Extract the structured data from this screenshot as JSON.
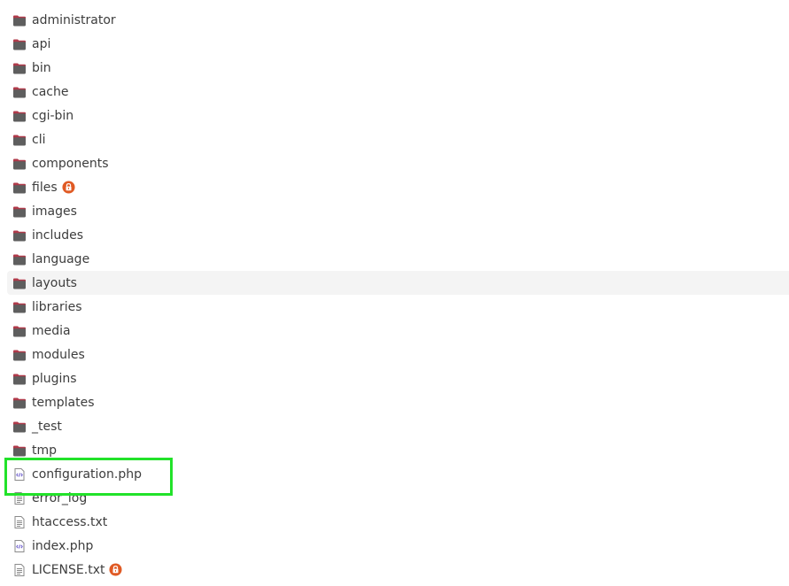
{
  "colors": {
    "folder_body": "#5e5e5e",
    "folder_tab": "#b03a4a",
    "lock_badge": "#e05a24",
    "highlight_border": "#22e22a",
    "hover_row": "#f4f4f4",
    "text": "#3d3d3d"
  },
  "items": [
    {
      "name": "administrator",
      "type": "folder",
      "icon": "folder-icon"
    },
    {
      "name": "api",
      "type": "folder",
      "icon": "folder-icon"
    },
    {
      "name": "bin",
      "type": "folder",
      "icon": "folder-icon"
    },
    {
      "name": "cache",
      "type": "folder",
      "icon": "folder-icon"
    },
    {
      "name": "cgi-bin",
      "type": "folder",
      "icon": "folder-icon"
    },
    {
      "name": "cli",
      "type": "folder",
      "icon": "folder-icon"
    },
    {
      "name": "components",
      "type": "folder",
      "icon": "folder-icon"
    },
    {
      "name": "files",
      "type": "folder",
      "icon": "folder-icon",
      "locked": true
    },
    {
      "name": "images",
      "type": "folder",
      "icon": "folder-icon"
    },
    {
      "name": "includes",
      "type": "folder",
      "icon": "folder-icon"
    },
    {
      "name": "language",
      "type": "folder",
      "icon": "folder-icon"
    },
    {
      "name": "layouts",
      "type": "folder",
      "icon": "folder-icon",
      "hovered": true
    },
    {
      "name": "libraries",
      "type": "folder",
      "icon": "folder-icon"
    },
    {
      "name": "media",
      "type": "folder",
      "icon": "folder-icon"
    },
    {
      "name": "modules",
      "type": "folder",
      "icon": "folder-icon"
    },
    {
      "name": "plugins",
      "type": "folder",
      "icon": "folder-icon"
    },
    {
      "name": "templates",
      "type": "folder",
      "icon": "folder-icon"
    },
    {
      "name": "_test",
      "type": "folder",
      "icon": "folder-icon"
    },
    {
      "name": "tmp",
      "type": "folder",
      "icon": "folder-icon"
    },
    {
      "name": "configuration.php",
      "type": "php",
      "icon": "php-file-icon",
      "highlighted": true
    },
    {
      "name": "error_log",
      "type": "text",
      "icon": "text-file-icon"
    },
    {
      "name": "htaccess.txt",
      "type": "text",
      "icon": "text-file-icon"
    },
    {
      "name": "index.php",
      "type": "php",
      "icon": "php-file-icon"
    },
    {
      "name": "LICENSE.txt",
      "type": "text",
      "icon": "text-file-icon",
      "locked": true
    }
  ]
}
